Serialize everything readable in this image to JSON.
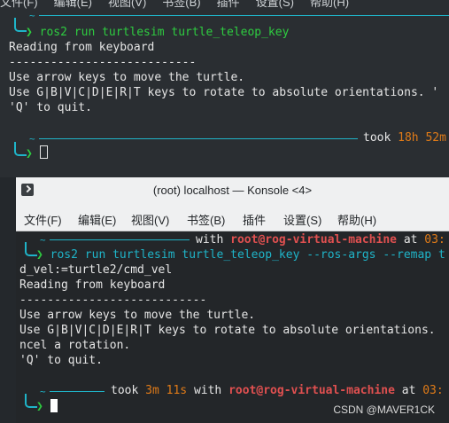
{
  "back_terminal": {
    "menubar": [
      "文件(F)",
      "编辑(E)",
      "视图(V)",
      "书签(B)",
      "插件",
      "设置(S)",
      "帮助(H)"
    ],
    "prompt_dir": "~",
    "command": "ros2 run turtlesim turtle_teleop_key",
    "output": [
      "Reading from keyboard",
      "---------------------------",
      "Use arrow keys to move the turtle.",
      "Use G|B|V|C|D|E|R|T keys to rotate to absolute orientations. '",
      "'Q' to quit."
    ],
    "took_label": "took",
    "took_value": "18h 52m"
  },
  "front_window": {
    "title": "(root) localhost — Konsole <4>",
    "menu": [
      "文件(F)",
      "编辑(E)",
      "视图(V)",
      "书签(B)",
      "插件",
      "设置(S)",
      "帮助(H)"
    ],
    "prompt_dir": "~",
    "with_label": "with",
    "user_host": "root@rog-virtual-machine",
    "at_label": "at",
    "time_clip": "03:",
    "command_line1": "ros2 run turtlesim turtle_teleop_key --ros-args --remap t",
    "command_line2": "d_vel:=turtle2/cmd_vel",
    "output": [
      "Reading from keyboard",
      "---------------------------",
      "Use arrow keys to move the turtle.",
      "Use G|B|V|C|D|E|R|T keys to rotate to absolute orientations.",
      "ncel a rotation.",
      "'Q' to quit."
    ],
    "took_label": "took",
    "took_value": "3m 11s"
  },
  "watermark": "CSDN @MAVER1CK",
  "colors": {
    "prompt_cyan": "#1fb4c8",
    "prompt_arrow_green": "#2ecc40",
    "took_orange": "#e07b18",
    "user_red": "#e05050"
  }
}
